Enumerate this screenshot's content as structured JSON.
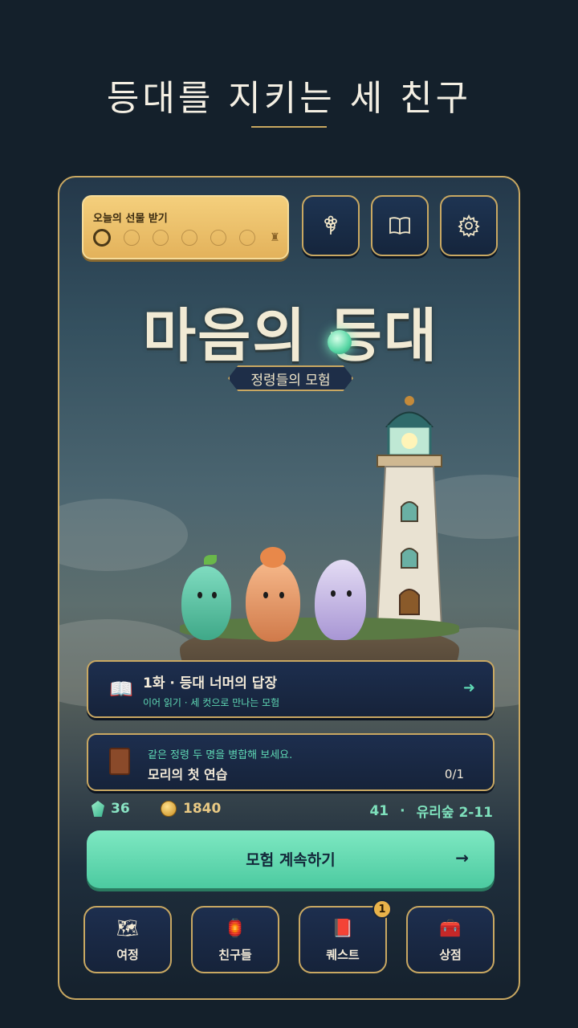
{
  "headline": "등대를 지키는 세 친구",
  "gift": {
    "title": "오늘의 선물 받기",
    "total_days": 6,
    "claimed_index": 0
  },
  "top_buttons": [
    {
      "name": "flower-icon"
    },
    {
      "name": "book-icon"
    },
    {
      "name": "gear-icon"
    }
  ],
  "logo": {
    "title": "마음의 등대",
    "subtitle": "정령들의 모험"
  },
  "chapter_card": {
    "title": "1화 · 등대 너머의 답장",
    "subtitle": "이어 읽기 · 세 컷으로 만나는 모험",
    "icon": "open-book-icon"
  },
  "quest_card": {
    "hint": "같은 정령 두 명을 병합해 보세요.",
    "title": "모리의 첫 연습",
    "progress": "0/1",
    "icon": "journal-icon"
  },
  "stats": {
    "gems": "36",
    "coins": "1840",
    "level": "41",
    "separator": "·",
    "stage": "유리숲 2-11"
  },
  "cta": {
    "label": "모험 계속하기",
    "arrow": "→"
  },
  "nav": [
    {
      "label": "여정",
      "icon": "map-icon"
    },
    {
      "label": "친구들",
      "icon": "lantern-icon"
    },
    {
      "label": "퀘스트",
      "icon": "journal-icon",
      "badge": "1"
    },
    {
      "label": "상점",
      "icon": "chest-icon"
    }
  ],
  "colors": {
    "accent": "#5fd8b4",
    "gold": "#c9a862",
    "panel": "#1d2e4e",
    "background": "#14202b"
  }
}
